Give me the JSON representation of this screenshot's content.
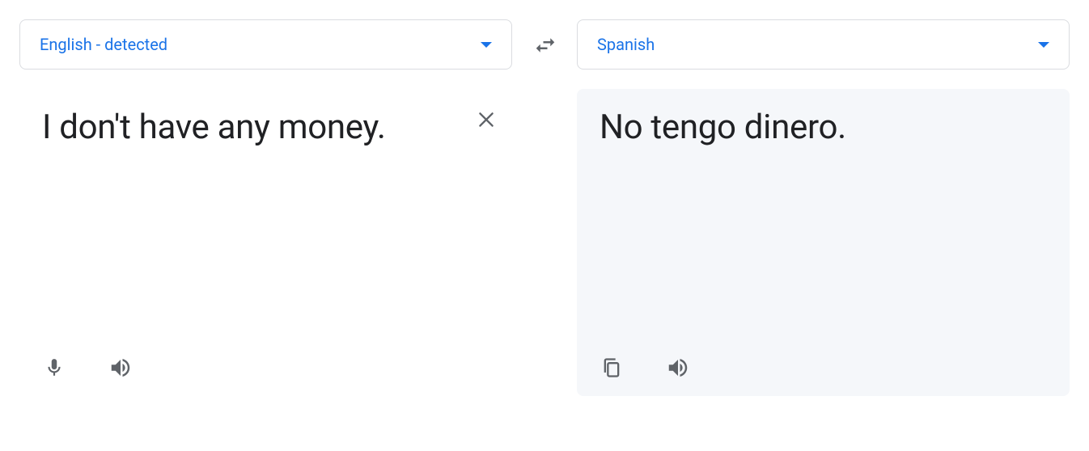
{
  "source": {
    "language": "English - detected",
    "text": "I don't have any money."
  },
  "target": {
    "language": "Spanish",
    "text": "No tengo dinero."
  }
}
